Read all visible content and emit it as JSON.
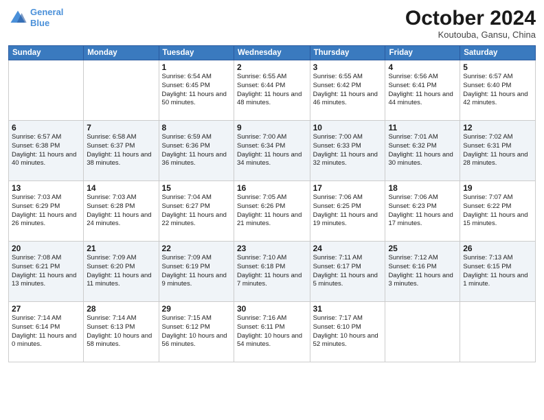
{
  "logo": {
    "line1": "General",
    "line2": "Blue"
  },
  "title": "October 2024",
  "location": "Koutouba, Gansu, China",
  "days_of_week": [
    "Sunday",
    "Monday",
    "Tuesday",
    "Wednesday",
    "Thursday",
    "Friday",
    "Saturday"
  ],
  "weeks": [
    [
      {
        "day": "",
        "detail": ""
      },
      {
        "day": "",
        "detail": ""
      },
      {
        "day": "1",
        "detail": "Sunrise: 6:54 AM\nSunset: 6:45 PM\nDaylight: 11 hours and 50 minutes."
      },
      {
        "day": "2",
        "detail": "Sunrise: 6:55 AM\nSunset: 6:44 PM\nDaylight: 11 hours and 48 minutes."
      },
      {
        "day": "3",
        "detail": "Sunrise: 6:55 AM\nSunset: 6:42 PM\nDaylight: 11 hours and 46 minutes."
      },
      {
        "day": "4",
        "detail": "Sunrise: 6:56 AM\nSunset: 6:41 PM\nDaylight: 11 hours and 44 minutes."
      },
      {
        "day": "5",
        "detail": "Sunrise: 6:57 AM\nSunset: 6:40 PM\nDaylight: 11 hours and 42 minutes."
      }
    ],
    [
      {
        "day": "6",
        "detail": "Sunrise: 6:57 AM\nSunset: 6:38 PM\nDaylight: 11 hours and 40 minutes."
      },
      {
        "day": "7",
        "detail": "Sunrise: 6:58 AM\nSunset: 6:37 PM\nDaylight: 11 hours and 38 minutes."
      },
      {
        "day": "8",
        "detail": "Sunrise: 6:59 AM\nSunset: 6:36 PM\nDaylight: 11 hours and 36 minutes."
      },
      {
        "day": "9",
        "detail": "Sunrise: 7:00 AM\nSunset: 6:34 PM\nDaylight: 11 hours and 34 minutes."
      },
      {
        "day": "10",
        "detail": "Sunrise: 7:00 AM\nSunset: 6:33 PM\nDaylight: 11 hours and 32 minutes."
      },
      {
        "day": "11",
        "detail": "Sunrise: 7:01 AM\nSunset: 6:32 PM\nDaylight: 11 hours and 30 minutes."
      },
      {
        "day": "12",
        "detail": "Sunrise: 7:02 AM\nSunset: 6:31 PM\nDaylight: 11 hours and 28 minutes."
      }
    ],
    [
      {
        "day": "13",
        "detail": "Sunrise: 7:03 AM\nSunset: 6:29 PM\nDaylight: 11 hours and 26 minutes."
      },
      {
        "day": "14",
        "detail": "Sunrise: 7:03 AM\nSunset: 6:28 PM\nDaylight: 11 hours and 24 minutes."
      },
      {
        "day": "15",
        "detail": "Sunrise: 7:04 AM\nSunset: 6:27 PM\nDaylight: 11 hours and 22 minutes."
      },
      {
        "day": "16",
        "detail": "Sunrise: 7:05 AM\nSunset: 6:26 PM\nDaylight: 11 hours and 21 minutes."
      },
      {
        "day": "17",
        "detail": "Sunrise: 7:06 AM\nSunset: 6:25 PM\nDaylight: 11 hours and 19 minutes."
      },
      {
        "day": "18",
        "detail": "Sunrise: 7:06 AM\nSunset: 6:23 PM\nDaylight: 11 hours and 17 minutes."
      },
      {
        "day": "19",
        "detail": "Sunrise: 7:07 AM\nSunset: 6:22 PM\nDaylight: 11 hours and 15 minutes."
      }
    ],
    [
      {
        "day": "20",
        "detail": "Sunrise: 7:08 AM\nSunset: 6:21 PM\nDaylight: 11 hours and 13 minutes."
      },
      {
        "day": "21",
        "detail": "Sunrise: 7:09 AM\nSunset: 6:20 PM\nDaylight: 11 hours and 11 minutes."
      },
      {
        "day": "22",
        "detail": "Sunrise: 7:09 AM\nSunset: 6:19 PM\nDaylight: 11 hours and 9 minutes."
      },
      {
        "day": "23",
        "detail": "Sunrise: 7:10 AM\nSunset: 6:18 PM\nDaylight: 11 hours and 7 minutes."
      },
      {
        "day": "24",
        "detail": "Sunrise: 7:11 AM\nSunset: 6:17 PM\nDaylight: 11 hours and 5 minutes."
      },
      {
        "day": "25",
        "detail": "Sunrise: 7:12 AM\nSunset: 6:16 PM\nDaylight: 11 hours and 3 minutes."
      },
      {
        "day": "26",
        "detail": "Sunrise: 7:13 AM\nSunset: 6:15 PM\nDaylight: 11 hours and 1 minute."
      }
    ],
    [
      {
        "day": "27",
        "detail": "Sunrise: 7:14 AM\nSunset: 6:14 PM\nDaylight: 11 hours and 0 minutes."
      },
      {
        "day": "28",
        "detail": "Sunrise: 7:14 AM\nSunset: 6:13 PM\nDaylight: 10 hours and 58 minutes."
      },
      {
        "day": "29",
        "detail": "Sunrise: 7:15 AM\nSunset: 6:12 PM\nDaylight: 10 hours and 56 minutes."
      },
      {
        "day": "30",
        "detail": "Sunrise: 7:16 AM\nSunset: 6:11 PM\nDaylight: 10 hours and 54 minutes."
      },
      {
        "day": "31",
        "detail": "Sunrise: 7:17 AM\nSunset: 6:10 PM\nDaylight: 10 hours and 52 minutes."
      },
      {
        "day": "",
        "detail": ""
      },
      {
        "day": "",
        "detail": ""
      }
    ]
  ]
}
